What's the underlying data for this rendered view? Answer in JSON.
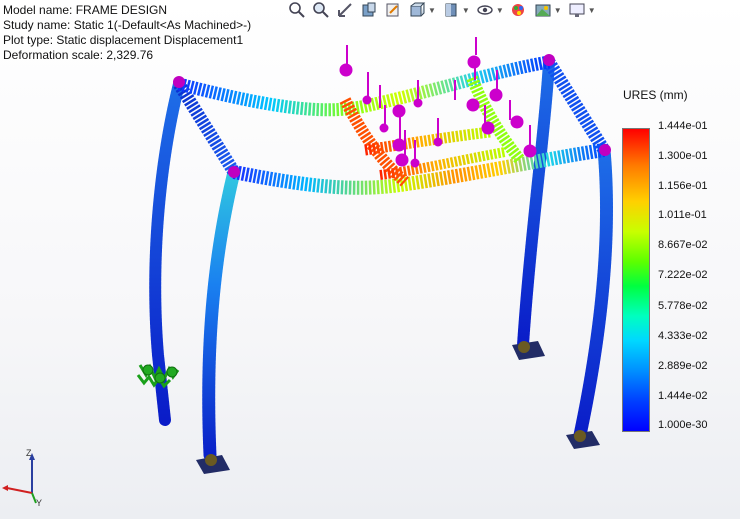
{
  "info": {
    "model_name": "Model name: FRAME DESIGN",
    "study_name": "Study name: Static 1(-Default<As Machined>-)",
    "plot_type": "Plot type: Static displacement Displacement1",
    "deformation_scale": "Deformation scale: 2,329.76"
  },
  "toolbar": {
    "icons": [
      "zoom-to-fit-icon",
      "zoom-area-icon",
      "previous-view-icon",
      "section-view-icon",
      "dynamic-annotation-icon",
      "view-orientation-icon",
      "display-style-icon",
      "hide-show-icon",
      "edit-appearance-icon",
      "apply-scene-icon",
      "view-settings-icon"
    ]
  },
  "legend": {
    "title": "URES (mm)",
    "labels": [
      "1.444e-01",
      "1.300e-01",
      "1.156e-01",
      "1.011e-01",
      "8.667e-02",
      "7.222e-02",
      "5.778e-02",
      "4.333e-02",
      "2.889e-02",
      "1.444e-02",
      "1.000e-30"
    ]
  },
  "triad": {
    "z": "Z",
    "y": "Y"
  },
  "colors": {
    "max": "#ff0000",
    "min": "#0000ff",
    "load_arrow": "#cc00cc",
    "fixture": "#22aa22"
  }
}
